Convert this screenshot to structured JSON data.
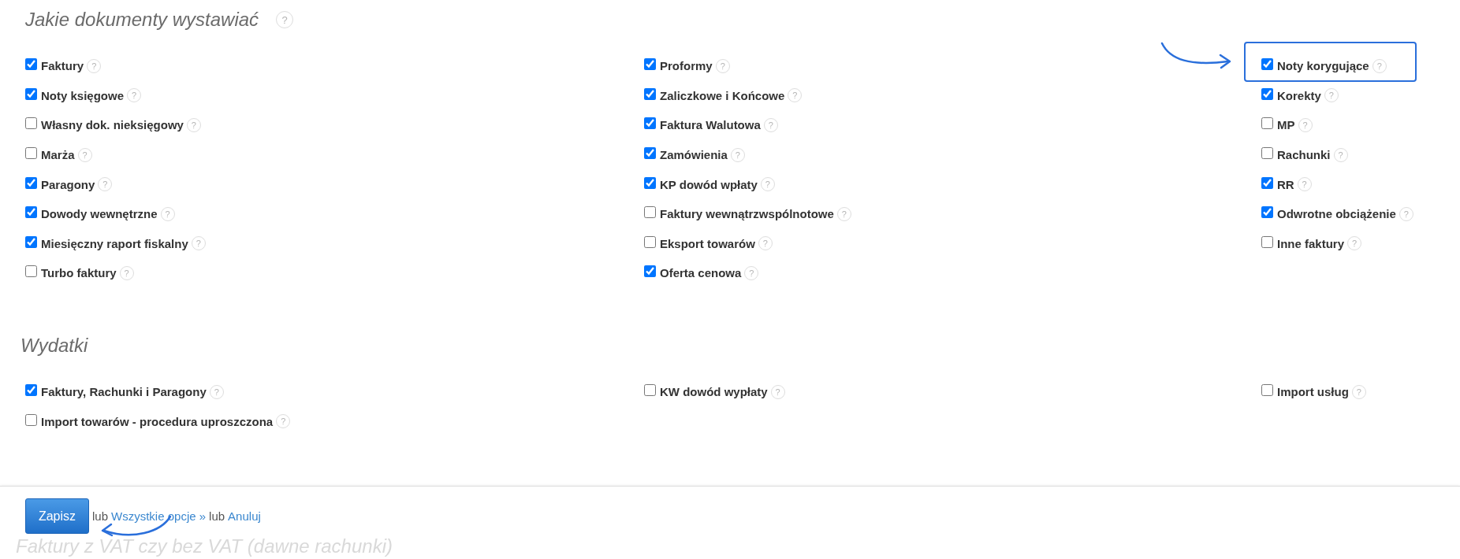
{
  "sections": [
    {
      "title": "Jakie dokumenty wystawiać",
      "help": "?",
      "columns": [
        [
          {
            "label": "Faktury",
            "help": "?",
            "checked": true,
            "highlighted": false
          },
          {
            "label": "Noty księgowe",
            "help": "?",
            "checked": true,
            "highlighted": false
          },
          {
            "label": "Własny dok. nieksięgowy",
            "help": "?",
            "checked": false,
            "highlighted": false
          },
          {
            "label": "Marża",
            "help": "?",
            "checked": false,
            "highlighted": false
          },
          {
            "label": "Paragony",
            "help": "?",
            "checked": true,
            "highlighted": false
          },
          {
            "label": "Dowody wewnętrzne",
            "help": "?",
            "checked": true,
            "highlighted": false
          },
          {
            "label": "Miesięczny raport fiskalny",
            "help": "?",
            "checked": true,
            "highlighted": false
          },
          {
            "label": "Turbo faktury",
            "help": "?",
            "checked": false,
            "highlighted": false
          }
        ],
        [
          {
            "label": "Proformy",
            "help": "?",
            "checked": true,
            "highlighted": false
          },
          {
            "label": "Zaliczkowe i Końcowe",
            "help": "?",
            "checked": true,
            "highlighted": false
          },
          {
            "label": "Faktura Walutowa",
            "help": "?",
            "checked": true,
            "highlighted": false
          },
          {
            "label": "Zamówienia",
            "help": "?",
            "checked": true,
            "highlighted": false
          },
          {
            "label": "KP dowód wpłaty",
            "help": "?",
            "checked": true,
            "highlighted": false
          },
          {
            "label": "Faktury wewnątrzwspólnotowe",
            "help": "?",
            "checked": false,
            "highlighted": false
          },
          {
            "label": "Eksport towarów",
            "help": "?",
            "checked": false,
            "highlighted": false
          },
          {
            "label": "Oferta cenowa",
            "help": "?",
            "checked": true,
            "highlighted": false
          }
        ],
        [
          {
            "label": "Noty korygujące",
            "help": "?",
            "checked": true,
            "highlighted": true
          },
          {
            "label": "Korekty",
            "help": "?",
            "checked": true,
            "highlighted": false
          },
          {
            "label": "MP",
            "help": "?",
            "checked": false,
            "highlighted": false
          },
          {
            "label": "Rachunki",
            "help": "?",
            "checked": false,
            "highlighted": false
          },
          {
            "label": "RR",
            "help": "?",
            "checked": true,
            "highlighted": false
          },
          {
            "label": "Odwrotne obciążenie",
            "help": "?",
            "checked": true,
            "highlighted": false
          },
          {
            "label": "Inne faktury",
            "help": "?",
            "checked": false,
            "highlighted": false
          }
        ]
      ]
    },
    {
      "title": "Wydatki",
      "columns": [
        [
          {
            "label": "Faktury, Rachunki i Paragony",
            "help": "?",
            "checked": true,
            "highlighted": false
          },
          {
            "label": "Import towarów - procedura uproszczona",
            "help": "?",
            "checked": false,
            "highlighted": false
          }
        ],
        [
          {
            "label": "KW dowód wypłaty",
            "help": "?",
            "checked": false,
            "highlighted": false
          }
        ],
        [
          {
            "label": "Import usług",
            "help": "?",
            "checked": false,
            "highlighted": false
          }
        ]
      ]
    }
  ],
  "footer": {
    "save": "Zapisz",
    "parts": [
      {
        "kind": "text",
        "text": "lub"
      },
      {
        "kind": "link",
        "text": "Wszystkie opcje »"
      },
      {
        "kind": "text",
        "text": "lub"
      },
      {
        "kind": "link",
        "text": "Anuluj"
      }
    ],
    "faded_heading": "Faktury z VAT czy bez VAT (dawne rachunki)"
  }
}
